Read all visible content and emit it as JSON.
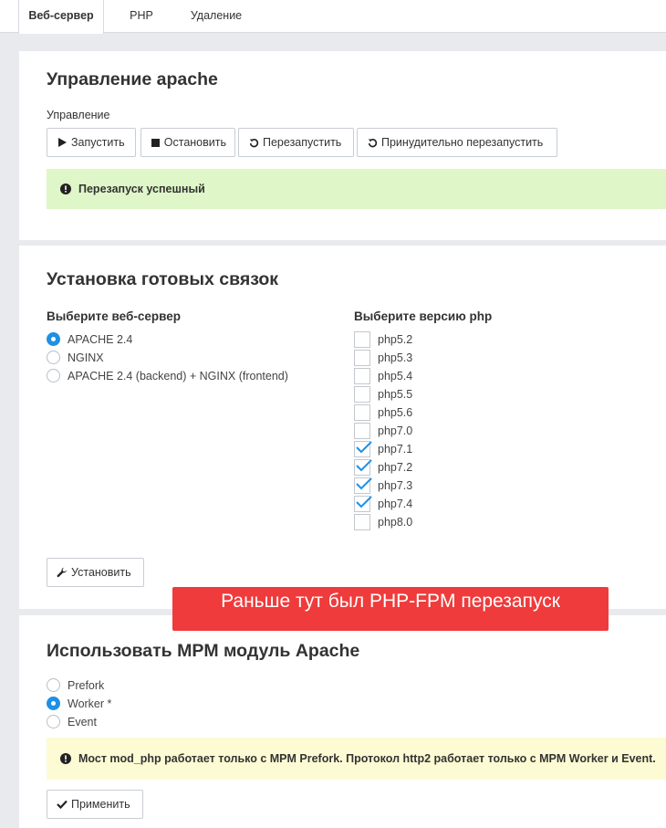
{
  "tabs": [
    {
      "label": "Веб-сервер",
      "active": true
    },
    {
      "label": "PHP",
      "active": false
    },
    {
      "label": "Удаление",
      "active": false
    }
  ],
  "apache_control": {
    "title": "Управление apache",
    "section_label": "Управление",
    "buttons": {
      "start": "Запустить",
      "stop": "Остановить",
      "restart": "Перезапустить",
      "force_restart": "Принудительно перезапустить"
    },
    "success_message": "Перезапуск успешный",
    "success_color": "#dff7c8"
  },
  "bundles": {
    "title": "Установка готовых связок",
    "webserver_label": "Выберите веб-сервер",
    "webservers": [
      {
        "label": "APACHE 2.4",
        "selected": true
      },
      {
        "label": "NGINX",
        "selected": false
      },
      {
        "label": "APACHE 2.4 (backend) + NGINX (frontend)",
        "selected": false
      }
    ],
    "php_label": "Выберите версию php",
    "php_versions": [
      {
        "label": "php5.2",
        "checked": false
      },
      {
        "label": "php5.3",
        "checked": false
      },
      {
        "label": "php5.4",
        "checked": false
      },
      {
        "label": "php5.5",
        "checked": false
      },
      {
        "label": "php5.6",
        "checked": false
      },
      {
        "label": "php7.0",
        "checked": false
      },
      {
        "label": "php7.1",
        "checked": true
      },
      {
        "label": "php7.2",
        "checked": true
      },
      {
        "label": "php7.3",
        "checked": true
      },
      {
        "label": "php7.4",
        "checked": true
      },
      {
        "label": "php8.0",
        "checked": false
      }
    ],
    "install_button": "Установить"
  },
  "overlay_banner": {
    "text": "Раньше тут был PHP-FPM перезапуск",
    "color": "#ef3b3b"
  },
  "mpm": {
    "title": "Использовать MPM модуль Apache",
    "options": [
      {
        "label": "Prefork",
        "selected": false
      },
      {
        "label": "Worker *",
        "selected": true
      },
      {
        "label": "Event",
        "selected": false
      }
    ],
    "warning": "Мост mod_php работает только с MPM Prefork. Протокол http2 работает только с MPM Worker и Event.",
    "warning_color": "#fdfbd3",
    "apply_button": "Применить"
  },
  "colors": {
    "accent": "#1e90e6",
    "page_bg": "#e8eaee"
  }
}
